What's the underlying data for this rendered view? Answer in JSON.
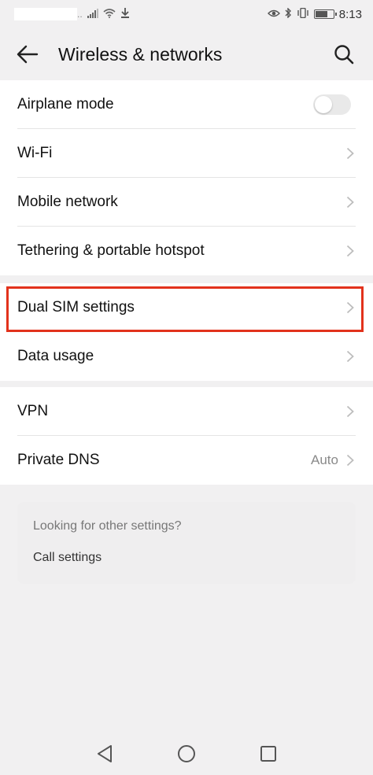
{
  "status_bar": {
    "carrier_suffix": "..",
    "time": "8:13",
    "icons": [
      "signal-icon",
      "wifi-icon",
      "download-icon",
      "eye-icon",
      "bluetooth-icon",
      "vibrate-icon",
      "battery-icon"
    ]
  },
  "header": {
    "title": "Wireless & networks",
    "back_icon": "back-arrow-icon",
    "search_icon": "search-icon"
  },
  "groups": [
    {
      "items": [
        {
          "label": "Airplane mode",
          "control": "toggle",
          "toggle_on": false
        },
        {
          "label": "Wi-Fi",
          "control": "chevron"
        },
        {
          "label": "Mobile network",
          "control": "chevron"
        },
        {
          "label": "Tethering & portable hotspot",
          "control": "chevron"
        }
      ]
    },
    {
      "items": [
        {
          "label": "Dual SIM settings",
          "control": "chevron",
          "highlighted": true
        },
        {
          "label": "Data usage",
          "control": "chevron"
        }
      ]
    },
    {
      "items": [
        {
          "label": "VPN",
          "control": "chevron"
        },
        {
          "label": "Private DNS",
          "value": "Auto",
          "control": "chevron"
        }
      ]
    }
  ],
  "suggestions": {
    "question": "Looking for other settings?",
    "link": "Call settings"
  },
  "nav_bar": {
    "icons": [
      "back-triangle-icon",
      "home-circle-icon",
      "recents-square-icon"
    ]
  },
  "colors": {
    "highlight": "#e2321c",
    "background": "#f1f0f1"
  }
}
